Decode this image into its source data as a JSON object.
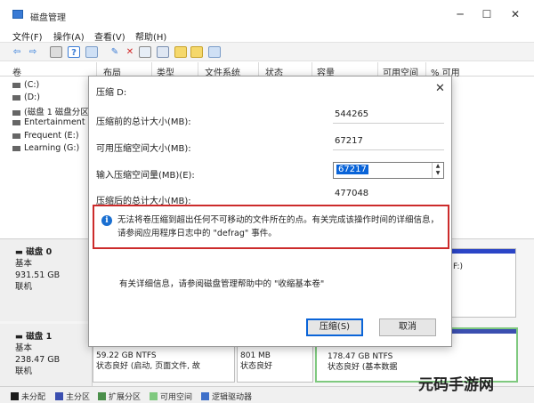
{
  "window": {
    "title": "磁盘管理",
    "controls": [
      "─",
      "☐",
      "✕"
    ]
  },
  "menu": [
    {
      "label": "文件(F)"
    },
    {
      "label": "操作(A)"
    },
    {
      "label": "查看(V)"
    },
    {
      "label": "帮助(H)"
    }
  ],
  "table": {
    "columns": [
      "卷",
      "布局",
      "类型",
      "文件系统",
      "状态",
      "容量",
      "可用空间",
      "% 可用"
    ],
    "volumes": [
      {
        "name": "(C:)"
      },
      {
        "name": "(D:)"
      },
      {
        "name": "(磁盘 1 磁盘分区 1)"
      },
      {
        "name": "Entertainment (F"
      },
      {
        "name": "Frequent (E:)"
      },
      {
        "name": "Learning (G:)"
      }
    ]
  },
  "disks": [
    {
      "name": "磁盘 0",
      "type": "基本",
      "size": "931.51 GB",
      "status": "联机"
    },
    {
      "name": "磁盘 1",
      "type": "基本",
      "size": "238.47 GB",
      "status": "联机"
    }
  ],
  "disk_partial": {
    "disk0_right_frag": "F:)",
    "disk1_part1": {
      "size": "59.22 GB NTFS",
      "status": "状态良好 (启动, 页面文件, 故"
    },
    "disk1_part2": {
      "size": "801 MB",
      "status": "状态良好"
    },
    "disk1_part3": {
      "size": "178.47 GB NTFS",
      "status": "状态良好 (基本数据"
    }
  },
  "legend": [
    {
      "label": "未分配",
      "color": "#1a1a1a"
    },
    {
      "label": "主分区",
      "color": "#3b4fb0"
    },
    {
      "label": "扩展分区",
      "color": "#4a8f4a"
    },
    {
      "label": "可用空间",
      "color": "#7fc97f"
    },
    {
      "label": "逻辑驱动器",
      "color": "#3d6fc9"
    }
  ],
  "dialog": {
    "title": "压缩 D:",
    "fields": [
      {
        "label": "压缩前的总计大小(MB):",
        "value": "544265"
      },
      {
        "label": "可用压缩空间大小(MB):",
        "value": "67217"
      },
      {
        "label": "输入压缩空间量(MB)(E):",
        "value": "67217"
      },
      {
        "label": "压缩后的总计大小(MB):",
        "value": "477048"
      }
    ],
    "warning": "无法将卷压缩到超出任何不可移动的文件所在的点。有关完成该操作时间的详细信息，请参阅应用程序日志中的 \"defrag\" 事件。",
    "help": "有关详细信息，请参阅磁盘管理帮助中的 \"收缩基本卷\"",
    "buttons": {
      "compress": "压缩(S)",
      "cancel": "取消"
    }
  },
  "watermark": "元码手游网",
  "colors": {
    "accent": "#0a64d8",
    "warning_border": "#cc2b2b",
    "primary_partition": "#3b4fb0"
  }
}
